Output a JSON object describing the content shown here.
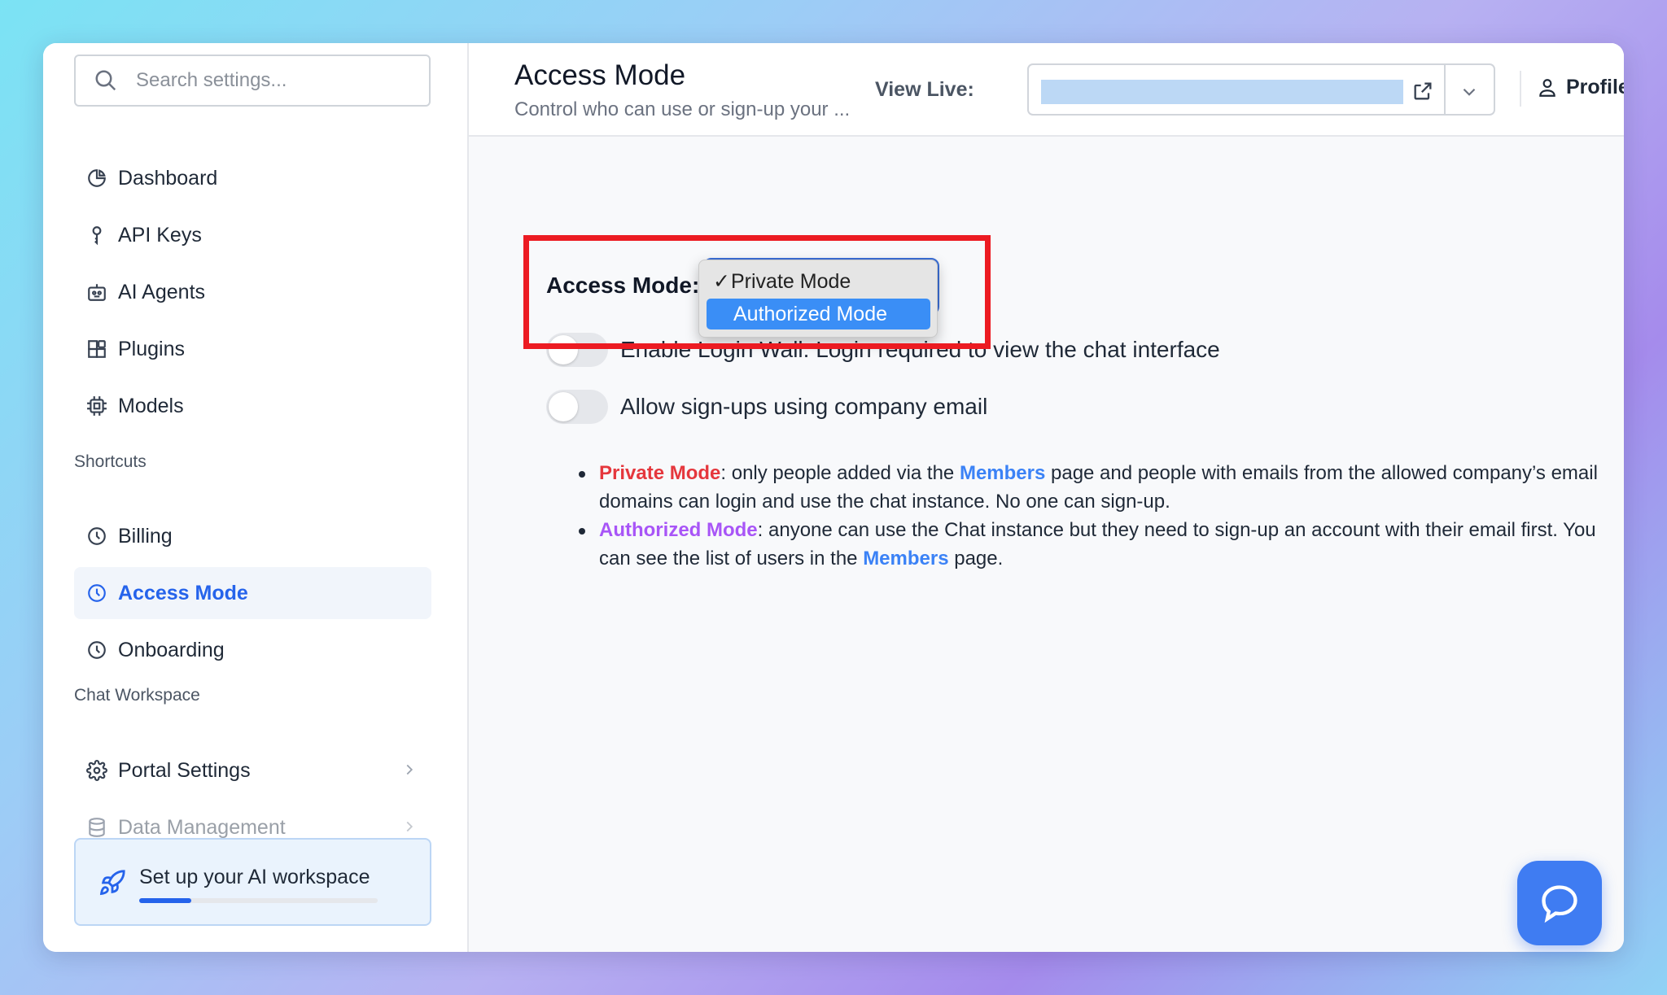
{
  "search": {
    "placeholder": "Search settings..."
  },
  "sidebar": {
    "nav": [
      {
        "label": "Dashboard"
      },
      {
        "label": "API Keys"
      },
      {
        "label": "AI Agents"
      },
      {
        "label": "Plugins"
      },
      {
        "label": "Models"
      }
    ],
    "shortcuts_title": "Shortcuts",
    "shortcuts": [
      {
        "label": "Billing"
      },
      {
        "label": "Access Mode"
      },
      {
        "label": "Onboarding"
      }
    ],
    "workspace_title": "Chat Workspace",
    "workspace": [
      {
        "label": "Portal Settings"
      },
      {
        "label": "Data Management"
      }
    ],
    "setup_card": {
      "title": "Set up your AI workspace",
      "progress": 0.22
    }
  },
  "header": {
    "title": "Access Mode",
    "subtitle": "Control who can use or sign-up your ...",
    "view_live_label": "View Live:",
    "profile_label": "Profile"
  },
  "content": {
    "access_mode_label": "Access Mode:",
    "dropdown": {
      "options": [
        {
          "label": "Private Mode",
          "checked": true
        },
        {
          "label": "Authorized Mode",
          "highlighted": true
        }
      ]
    },
    "toggles": [
      {
        "label": "Enable Login Wall: Login required to view the chat interface",
        "on": false
      },
      {
        "label": "Allow sign-ups using company email",
        "on": false
      }
    ],
    "notes": {
      "private_kw": "Private Mode",
      "private_text_1": ": only people added via the ",
      "members_link": "Members",
      "private_text_2": " page and people with emails from the allowed company’s email domains can login and use the chat instance. No one can sign-up.",
      "authorized_kw": "Authorized Mode",
      "authorized_text_1": ": anyone can use the Chat instance but they need to sign-up an account with their email first. You can see the list of users in the ",
      "authorized_text_2": " page."
    }
  },
  "colors": {
    "accent": "#2563eb",
    "highlight_box": "#ec1b22",
    "private_kw": "#e5373d",
    "authorized_kw": "#a855f7",
    "dropdown_selected": "#3a8ef6"
  }
}
